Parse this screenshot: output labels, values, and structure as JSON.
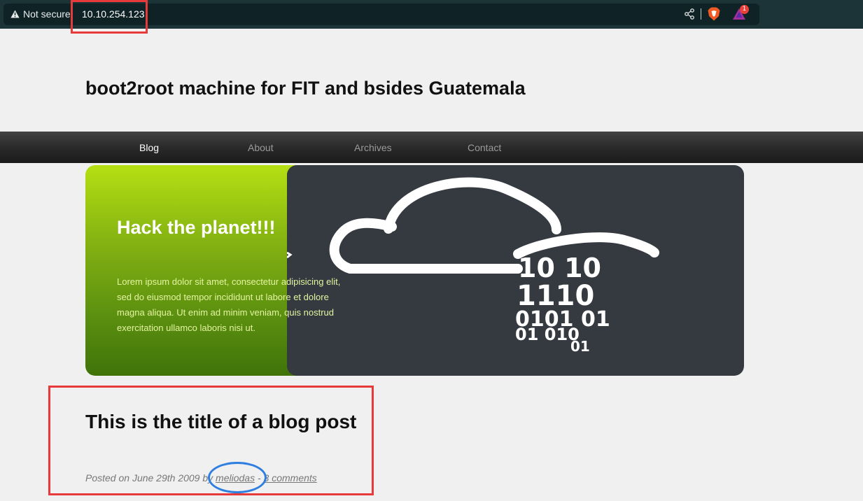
{
  "browser": {
    "security_label": "Not secure",
    "url": "10.10.254.123",
    "rewards_badge": "1",
    "icons": [
      "warning-icon",
      "share-icon",
      "brave-shield-icon",
      "brave-rewards-icon"
    ]
  },
  "site": {
    "title": "boot2root machine for FIT and bsides Guatemala"
  },
  "nav": {
    "items": [
      {
        "label": "Blog"
      },
      {
        "label": "About"
      },
      {
        "label": "Archives"
      },
      {
        "label": "Contact"
      }
    ]
  },
  "banner": {
    "heading": "Hack the planet!!!",
    "text": "Lorem ipsum dolor sit amet, consectetur adipisicing elit, sed do eiusmod tempor incididunt ut labore et dolore magna aliqua. Ut enim ad minim veniam, quis nostrud exercitation ullamco laboris nisi ut.",
    "graphic": {
      "binary_lines": [
        "10 10",
        "1110",
        "0101 01",
        "01 010",
        "01"
      ]
    }
  },
  "post": {
    "title": "This is the title of a blog post",
    "meta_prefix": "Posted on June 29th 2009 by ",
    "author": "meliodas",
    "separator": " - ",
    "comments": "3 comments"
  },
  "colors": {
    "annotation_rect": "#e8393b",
    "annotation_oval": "#2f7fe0",
    "banner_green_top": "#b5e013",
    "banner_green_bottom": "#3f7309",
    "banner_dark": "#353a40"
  }
}
